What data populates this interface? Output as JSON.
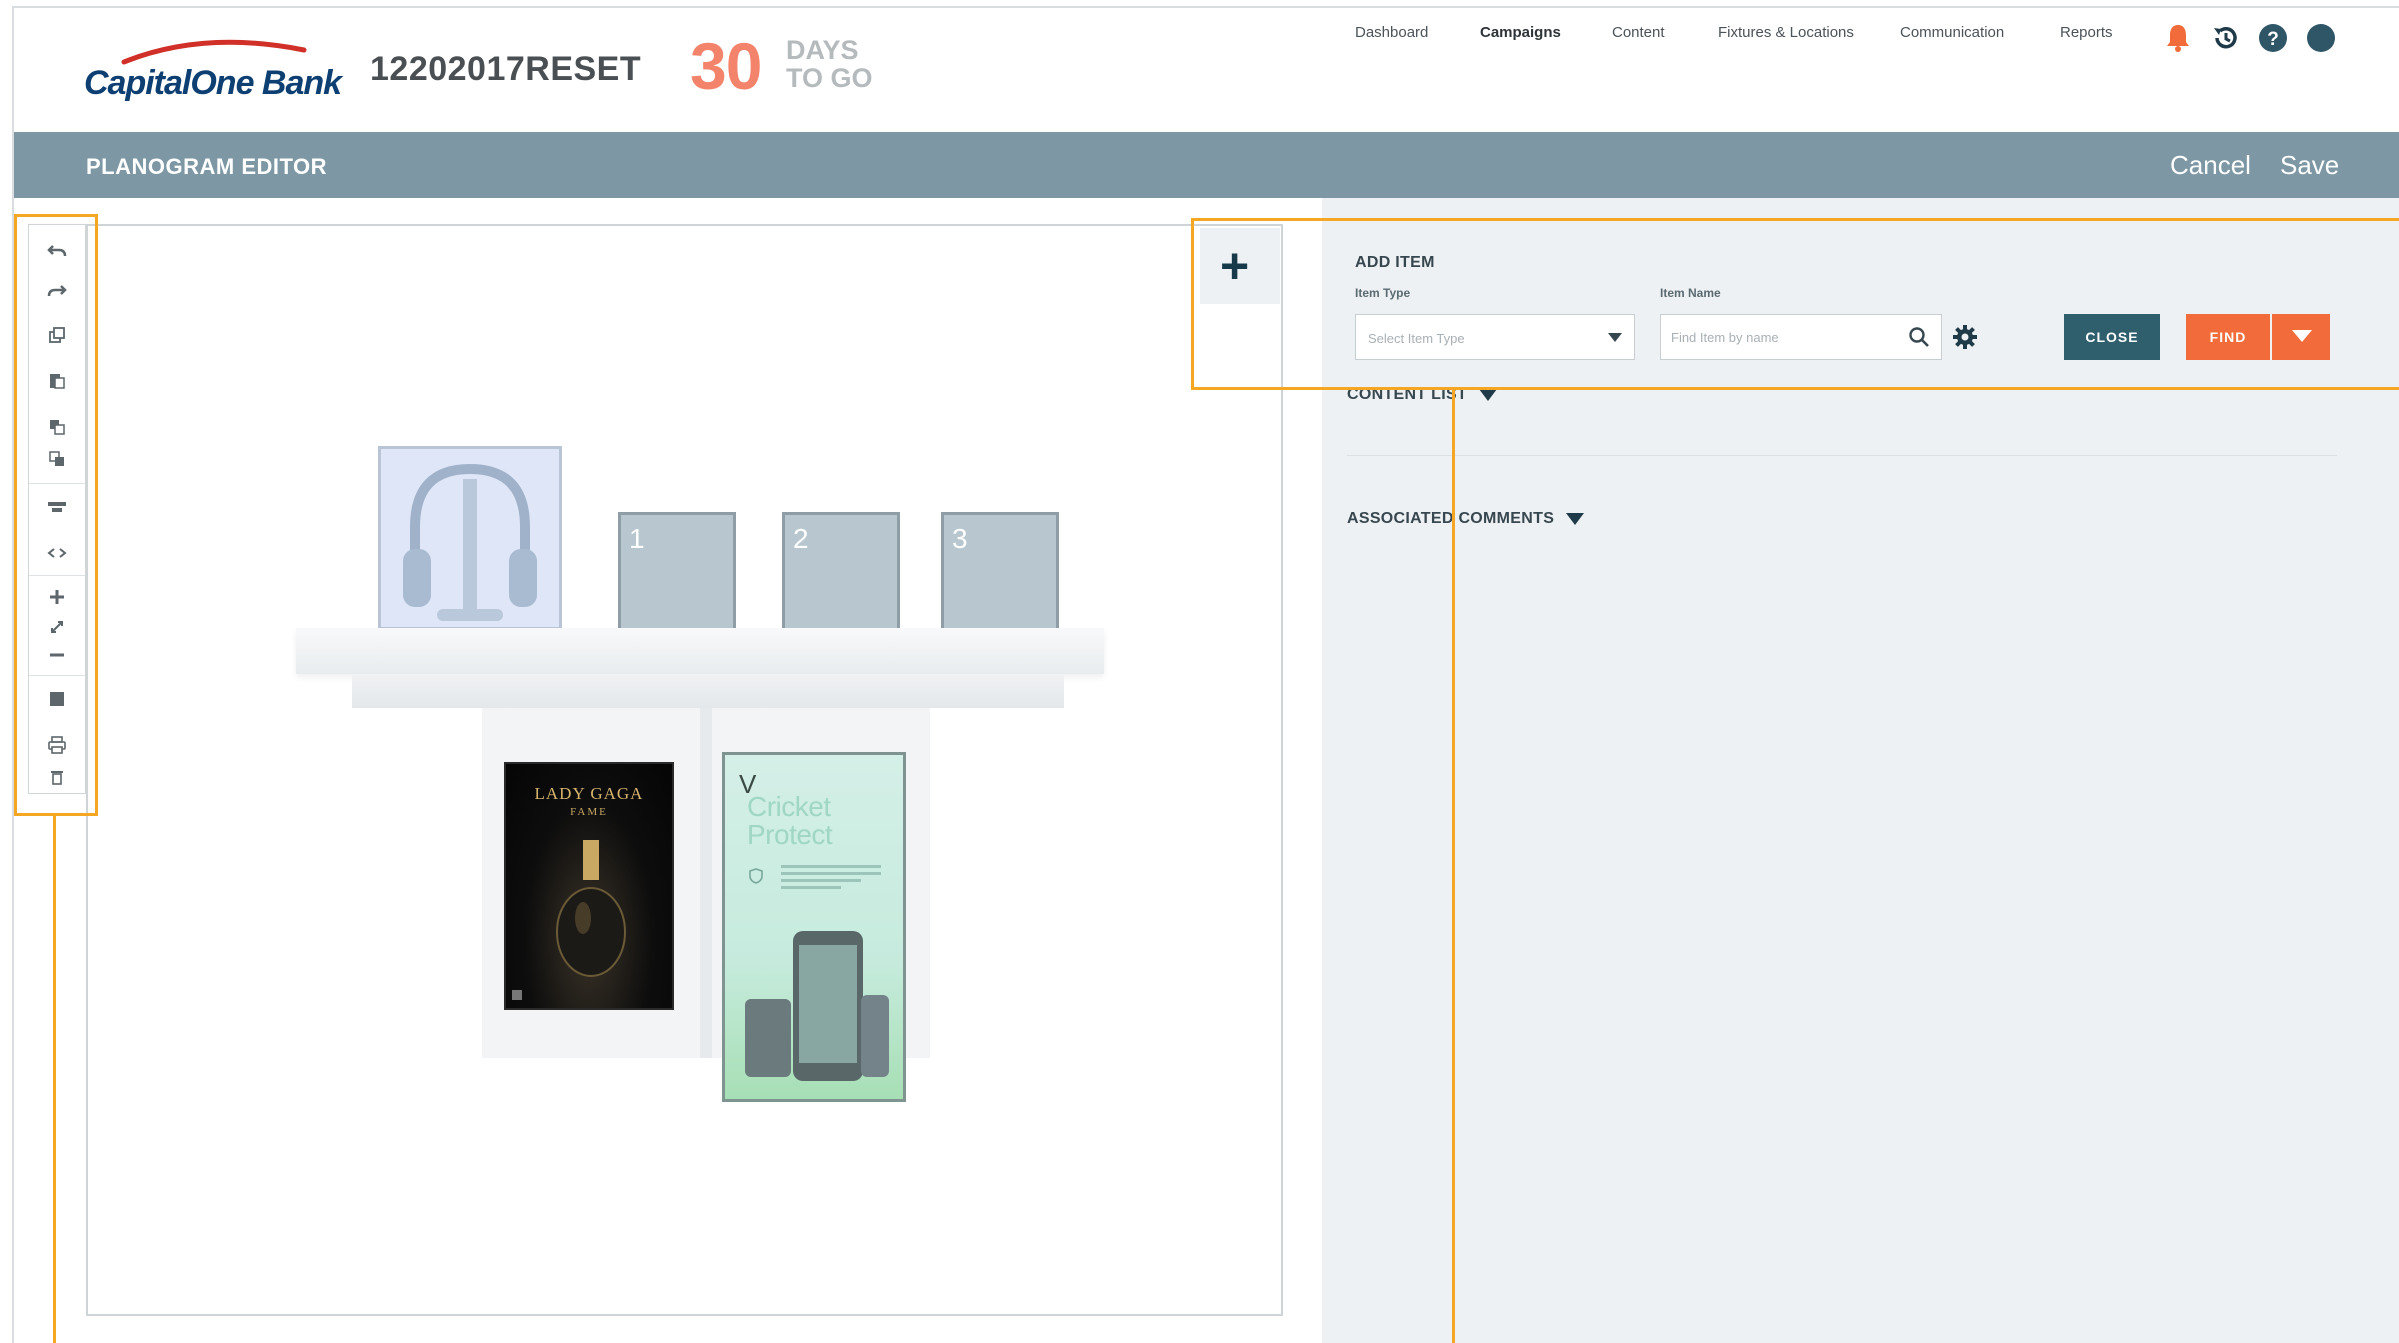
{
  "header": {
    "logo_text": "CapitalOne Bank",
    "campaign_name": "12202017RESET",
    "days_number": "30",
    "days_label_line1": "DAYS",
    "days_label_line2": "TO GO",
    "nav": [
      {
        "label": "Dashboard"
      },
      {
        "label": "Campaigns"
      },
      {
        "label": "Content"
      },
      {
        "label": "Fixtures & Locations"
      },
      {
        "label": "Communication"
      },
      {
        "label": "Reports"
      }
    ],
    "active_nav": "Campaigns",
    "icons": [
      "bell-icon",
      "history-icon",
      "help-icon",
      "user-avatar-icon"
    ],
    "colors": {
      "accent": "#f3836b",
      "brand": "#0d3f72"
    }
  },
  "editor_bar": {
    "title": "PLANOGRAM EDITOR",
    "cancel_label": "Cancel",
    "save_label": "Save",
    "color": "#7d97a4"
  },
  "toolbar": {
    "tools": [
      "undo-icon",
      "redo-icon",
      "copy-icon",
      "paste-icon",
      "bring-forward-icon",
      "send-backward-icon",
      "align-icon",
      "flip-icon",
      "zoom-in-icon",
      "fit-icon",
      "zoom-out-icon",
      "grid-icon",
      "print-icon",
      "delete-icon"
    ]
  },
  "planogram": {
    "slots": [
      {
        "label": "1"
      },
      {
        "label": "2"
      },
      {
        "label": "3"
      }
    ],
    "poster_left": {
      "title": "LADY GAGA",
      "subtitle": "FAME"
    },
    "poster_right": {
      "mark": "V",
      "title_line1": "Cricket",
      "title_line2": "Protect"
    }
  },
  "add_item": {
    "heading": "ADD ITEM",
    "item_type_label": "Item Type",
    "item_type_placeholder": "Select Item Type",
    "item_name_label": "Item Name",
    "item_name_placeholder": "Find Item by name",
    "close_label": "CLOSE",
    "find_label": "FIND",
    "colors": {
      "close": "#2f5f6d",
      "find": "#f26b3a"
    }
  },
  "sections": {
    "content_list": "CONTENT LIST",
    "associated_comments": "ASSOCIATED COMMENTS"
  }
}
